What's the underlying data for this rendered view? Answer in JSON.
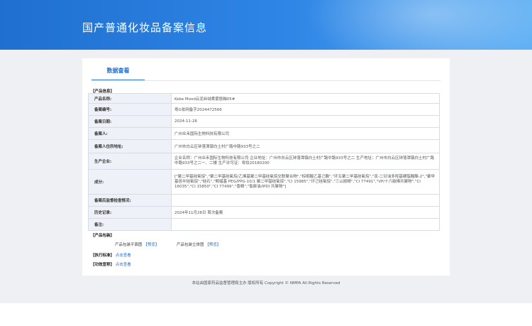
{
  "header": {
    "title": "国产普通化妆品备案信息"
  },
  "tab": {
    "label": "数据查看"
  },
  "product_info": {
    "section_label": "【产品信息】",
    "rows": [
      {
        "key": "产品名称:",
        "value": "Keke Mood云泥丝绒柔雾唇釉05#"
      },
      {
        "key": "备案编号:",
        "value": "粤G妆网备字2024472566"
      },
      {
        "key": "备案日期:",
        "value": "2024-11-26"
      },
      {
        "key": "备案人:",
        "value": "广州众禾国际生物科技有限公司"
      },
      {
        "key": "备案人住所地址:",
        "value": "广州市白云区钟落潭镇白土村广路中路933号之二"
      },
      {
        "key": "生产企业:",
        "value": "企业名称：广州众禾国际生物科技有限公司 企业地址：广州市白云区钟落潭镇白土村广路中路933号之二 生产地址：广州市白云区钟落潭镇白土村广路中路933号之二一、二楼 生产许可证：粤妆20180200"
      },
      {
        "key": "成分:",
        "value": "[\"聚二甲基硅氧烷\",\"聚二甲基硅氧烷/乙烯基聚二甲基硅氧烷交联聚合物\",\"棕榈酸乙基己酯\",\"环五聚二甲基硅氧烷\",\"双-二甘油多羟基硬脂酸酯-2\",\"聚甲基倍半硅氧烷\",\"硅石\",\"鲸蜡基 PEG/PPG-10/1 聚二甲基硅氧烷\",\"CI 15985\",\"环己硅氧烷\",\"三山嵛精\",\"CI 77491\",\"VP/十六碳烯共聚物\",\"CI 16035\",\"CI 15850\",\"CI 77499\",\"香精\",\"氯麻油/IPDI 共聚物\"]"
      },
      {
        "key": "备案后监督检查情况:",
        "value": ""
      },
      {
        "key": "历史记录:",
        "value": "2024年11月28日 首次备案"
      },
      {
        "key": "备注:",
        "value": ""
      }
    ]
  },
  "packaging": {
    "section_label": "【产品包装】",
    "flat_label": "产品包装平面图",
    "flat_link": "【预览】",
    "stereo_label": "产品包装立体图",
    "stereo_link": "【预览】"
  },
  "standard": {
    "label": "【执行标准】",
    "link": "点击查看"
  },
  "efficacy": {
    "label": "【功效宣称】",
    "link": "点击查看"
  },
  "footer": {
    "text": "本站由国家药品监督管理局主办 版权所有 Copyright © NMPA All Rights Reserved"
  },
  "colors": {
    "banner_start": "#1f6fd0",
    "banner_end": "#5fb0f4",
    "accent": "#2b7fdb",
    "key_cell_bg": "#eef2f8"
  }
}
